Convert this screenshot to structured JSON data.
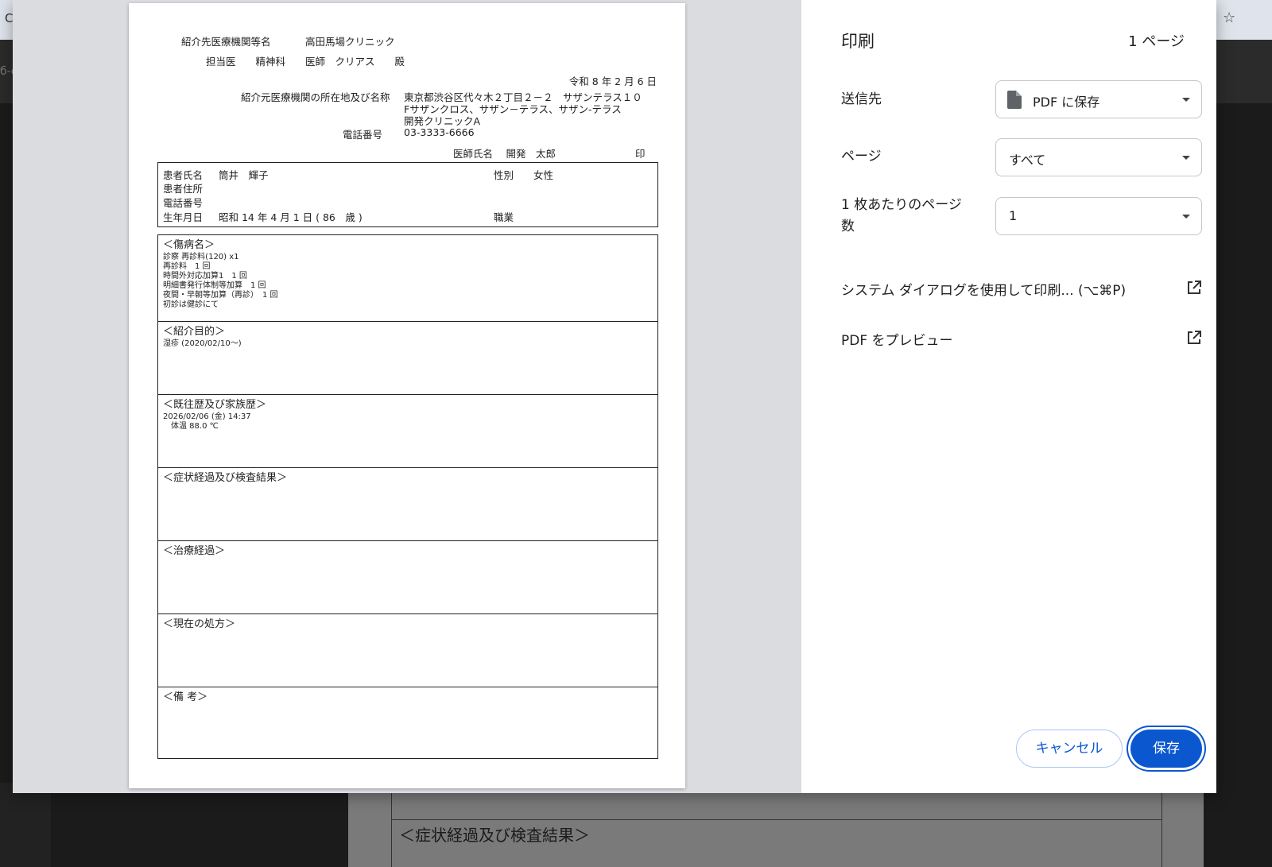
{
  "browser": {
    "tab_fragment": "C",
    "toolbar_fragment": "б-с",
    "bookmark_icon": "star-icon",
    "bg_section_label": "＜症状経過及び検査結果＞"
  },
  "document": {
    "dest_label": "紹介先医療機関等名",
    "dest_name": "高田馬場クリニック",
    "doctor_line": "担当医　　精神科　　医師　クリアス　　殿",
    "date": "令和 8 年 2 月 6 日",
    "origin_label": "紹介元医療機関の所在地及び名称",
    "origin_addr1": "東京都渋谷区代々木２丁目２－２　サザンテラス１０",
    "origin_addr2": "Fサザンクロス、サザン－テラス、サザン-テラス",
    "origin_name": "開発クリニックA",
    "phone_label": "電話番号",
    "phone": "03-3333-6666",
    "doctor_sig": "医師氏名　 開発　太郎",
    "seal": "印",
    "patient": {
      "name_label": "患者氏名",
      "name": "筒井　輝子",
      "sex_label": "性別",
      "sex": "女性",
      "address_label": "患者住所",
      "phone_label": "電話番号",
      "birth_label": "生年月日",
      "birth": "昭和 14 年 4 月 1 日 ( 86　歳 )",
      "job_label": "職業"
    },
    "sections": [
      {
        "title": "＜傷病名＞",
        "lines": [
          "診察 再診料(120) x1",
          "再診料　1 回",
          "時間外対応加算1　1 回",
          "明細書発行体制等加算　1 回",
          "夜間・早朝等加算（再診）　1 回",
          "初診は健診にて"
        ]
      },
      {
        "title": "＜紹介目的＞",
        "lines": [
          "湿疹 (2020/02/10〜)"
        ]
      },
      {
        "title": "＜既往歴及び家族歴＞",
        "lines": [
          "2026/02/06 (金) 14:37",
          "　体温 88.0 ℃"
        ]
      },
      {
        "title": "＜症状経過及び検査結果＞",
        "lines": []
      },
      {
        "title": "＜治療経過＞",
        "lines": []
      },
      {
        "title": "＜現在の処方＞",
        "lines": []
      },
      {
        "title": "＜備 考＞",
        "lines": []
      }
    ]
  },
  "print_panel": {
    "title": "印刷",
    "page_count": "1 ページ",
    "destination_label": "送信先",
    "destination_value": "PDF に保存",
    "pages_label": "ページ",
    "pages_value": "すべて",
    "pages_per_sheet_label_1": "1 枚あたりのページ",
    "pages_per_sheet_label_2": "数",
    "pages_per_sheet_value": "1",
    "system_dialog_label": "システム ダイアログを使用して印刷... (⌥⌘P)",
    "preview_pdf_label": "PDF をプレビュー",
    "cancel_label": "キャンセル",
    "save_label": "保存",
    "accent_color": "#0b57d0",
    "icons": [
      "document-icon",
      "dropdown-caret-icon",
      "external-link-icon"
    ]
  }
}
